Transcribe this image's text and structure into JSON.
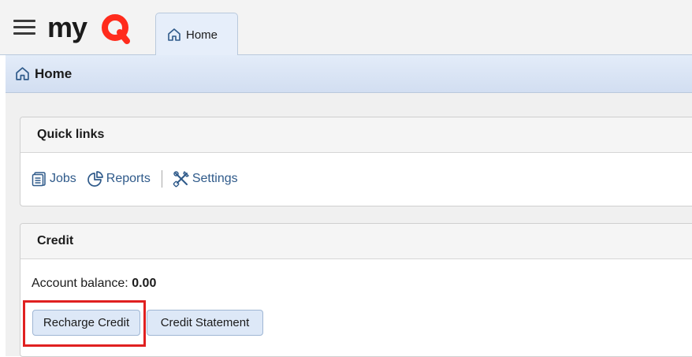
{
  "header": {
    "logo_text": "myQ",
    "menu_icon": "hamburger-menu-icon",
    "tabs": [
      {
        "label": "Home",
        "icon": "home-icon",
        "active": true
      }
    ]
  },
  "breadcrumb": {
    "label": "Home",
    "icon": "home-icon"
  },
  "quick_links": {
    "title": "Quick links",
    "items": [
      {
        "label": "Jobs",
        "icon": "jobs-icon"
      },
      {
        "label": "Reports",
        "icon": "reports-icon"
      },
      {
        "label": "Settings",
        "icon": "settings-icon"
      }
    ]
  },
  "credit": {
    "title": "Credit",
    "balance_label": "Account balance:",
    "balance_value": "0.00",
    "buttons": [
      {
        "label": "Recharge Credit",
        "highlighted": true
      },
      {
        "label": "Credit Statement"
      }
    ]
  },
  "colors": {
    "brand": "#1b1b1b",
    "link": "#2f5a8a",
    "highlight": "#e02020",
    "button_bg": "#dde8f7"
  }
}
